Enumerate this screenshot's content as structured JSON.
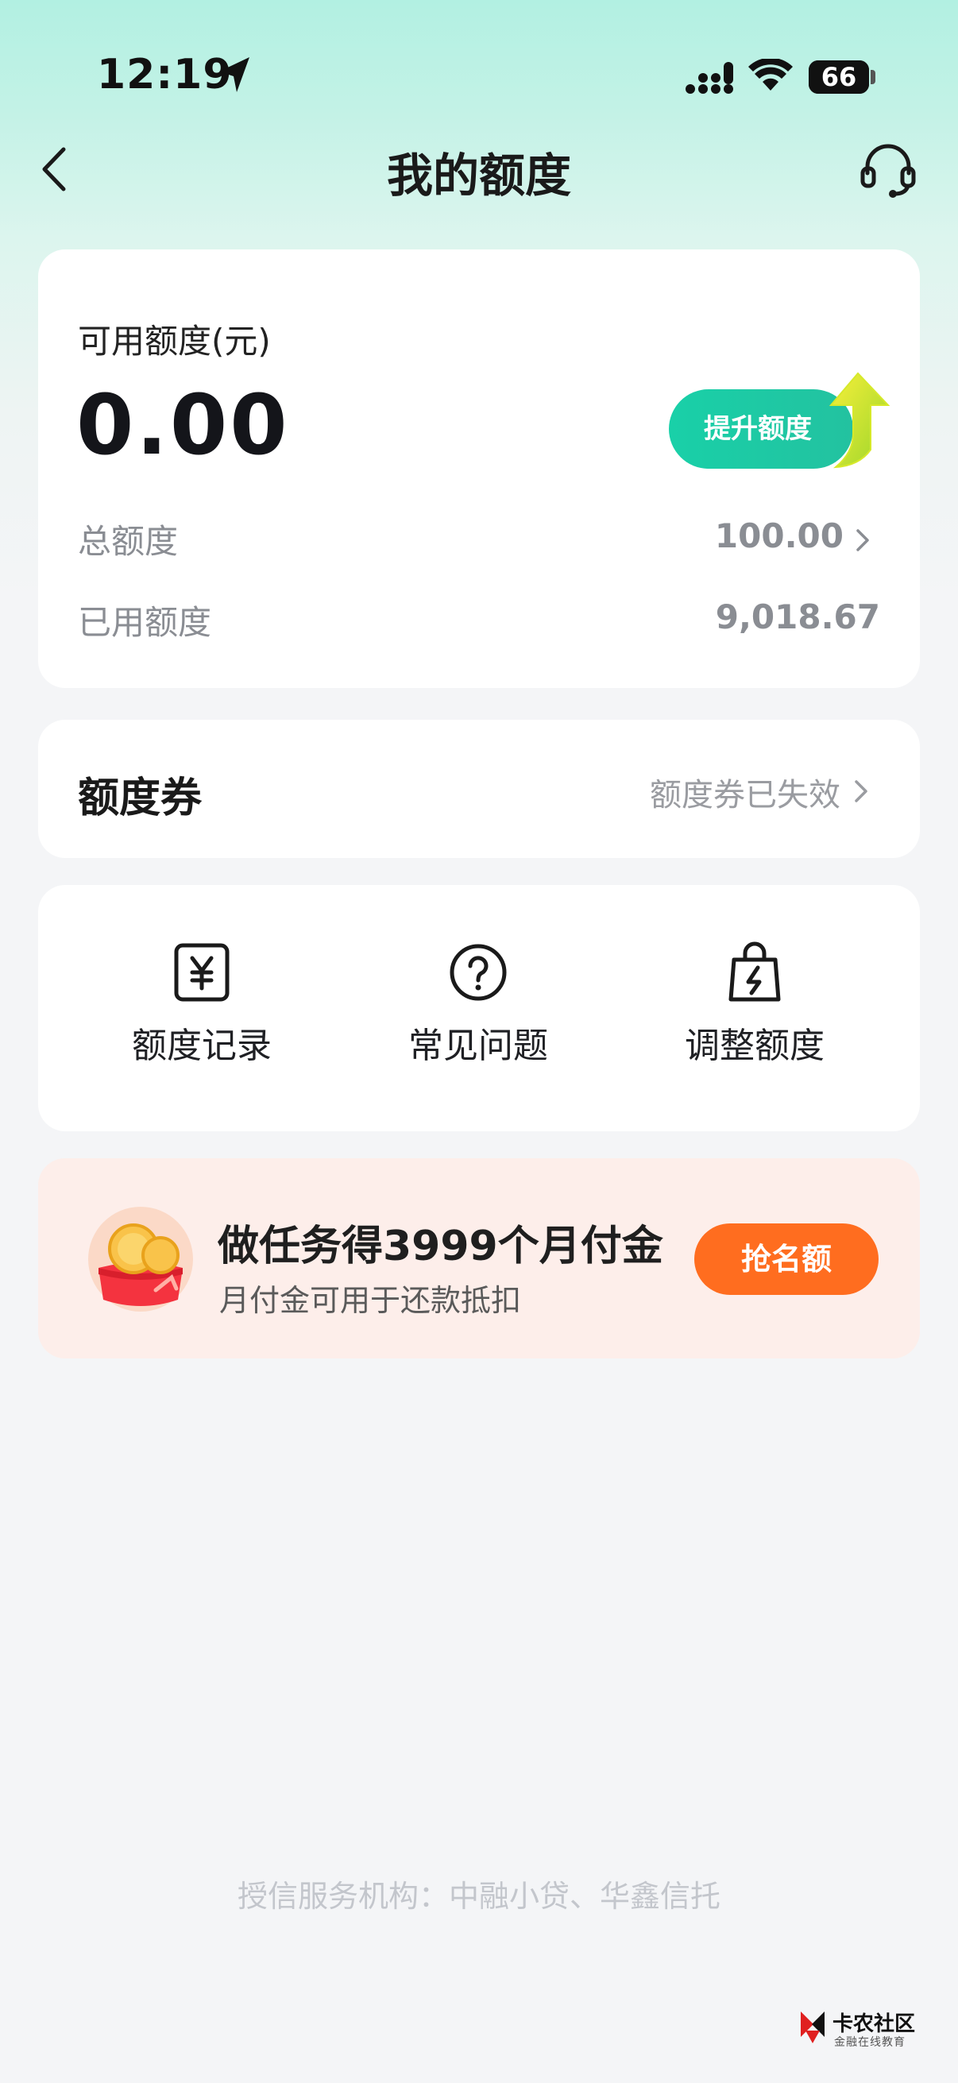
{
  "status_bar": {
    "time": "12:19",
    "battery": "66",
    "battery_fill": 0.66
  },
  "nav": {
    "title": "我的额度"
  },
  "quota_card": {
    "label": "可用额度(元)",
    "amount": "0.00",
    "raise_button": "提升额度",
    "total_label": "总额度",
    "total_value": "100.00",
    "used_label": "已用额度",
    "used_value": "9,018.67"
  },
  "coupon_card": {
    "title": "额度券",
    "status": "额度券已失效"
  },
  "actions": [
    {
      "label": "额度记录",
      "icon": "yen-record-icon"
    },
    {
      "label": "常见问题",
      "icon": "question-icon"
    },
    {
      "label": "调整额度",
      "icon": "bag-bolt-icon"
    }
  ],
  "promo": {
    "title": "做任务得3999个月付金",
    "subtitle": "月付金可用于还款抵扣",
    "button": "抢名额",
    "icon": "coin-redpacket-icon"
  },
  "footer": {
    "text": "授信服务机构：中融小贷、华鑫信托"
  },
  "watermark": {
    "title": "卡农社区",
    "subtitle": "金融在线教育"
  },
  "colors": {
    "accent": "#19d0a8",
    "promo_button": "#ff6d1f",
    "promo_bg": "#fdeeea"
  }
}
